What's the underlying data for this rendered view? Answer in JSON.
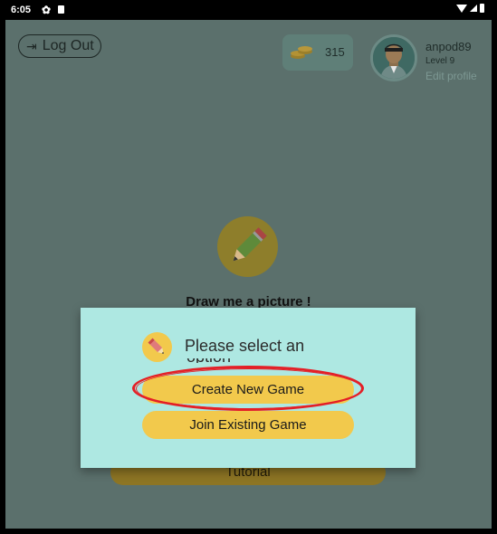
{
  "status_bar": {
    "time": "6:05"
  },
  "header": {
    "logout_label": "Log Out",
    "coins": "315",
    "username": "anpod89",
    "level": "Level 9",
    "edit_profile": "Edit profile"
  },
  "main": {
    "app_title": "Draw me a picture !",
    "tutorial_label": "Tutorial"
  },
  "dialog": {
    "title": "Please select an",
    "title_cut": "option",
    "create_label": "Create New Game",
    "join_label": "Join Existing Game"
  },
  "colors": {
    "background_dim": "#5b706c",
    "dialog_bg": "#aee8e2",
    "button_yellow": "#f2c94c",
    "highlight_red": "#e41f26"
  },
  "icons": [
    "settings-icon",
    "sd-card-icon",
    "wifi-icon",
    "signal-icon",
    "battery-icon",
    "logout-icon",
    "coins-icon",
    "avatar-icon",
    "pencil-icon"
  ]
}
